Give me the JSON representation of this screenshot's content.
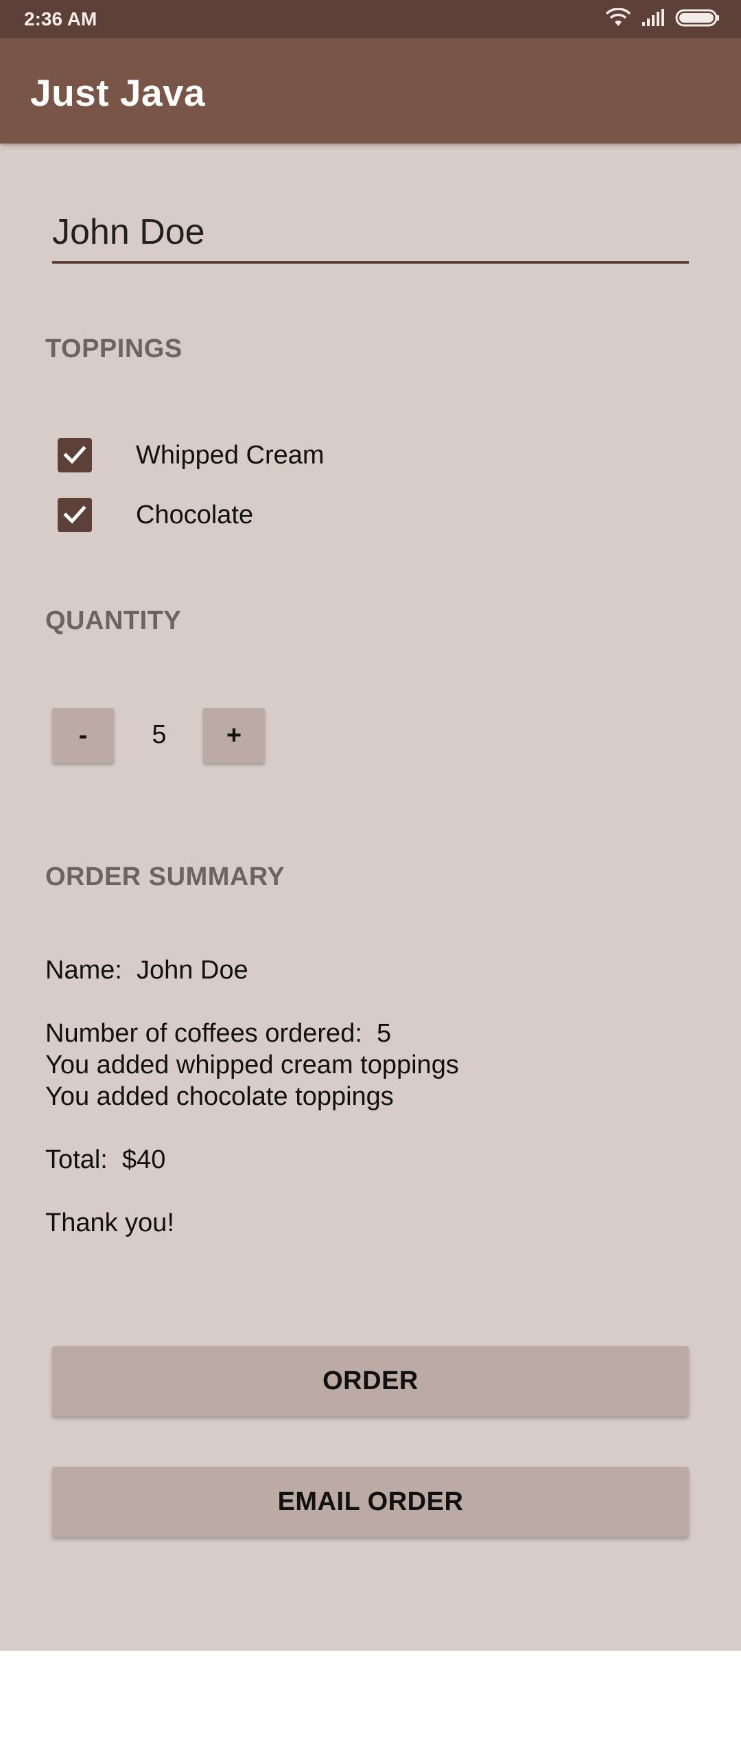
{
  "status_bar": {
    "time": "2:36 AM",
    "icons": [
      "wifi-icon",
      "signal-icon",
      "battery-icon"
    ]
  },
  "app_bar": {
    "title": "Just Java"
  },
  "name_field": {
    "value": "John Doe"
  },
  "toppings": {
    "header": "TOPPINGS",
    "items": [
      {
        "label": "Whipped Cream",
        "checked": true
      },
      {
        "label": "Chocolate",
        "checked": true
      }
    ]
  },
  "quantity": {
    "header": "QUANTITY",
    "decrement_label": "-",
    "value": "5",
    "increment_label": "+"
  },
  "order_summary": {
    "header": "ORDER SUMMARY",
    "name_line": "Name:  John Doe",
    "coffees_line": "Number of coffees ordered:  5",
    "whipped_line": "You added whipped cream toppings",
    "chocolate_line": "You added chocolate toppings",
    "total_line": "Total:  $40",
    "thanks_line": "Thank you!"
  },
  "buttons": {
    "order": "ORDER",
    "email_order": "EMAIL ORDER"
  },
  "colors": {
    "status_bar": "#5d4037",
    "app_bar": "#795548",
    "background": "#d7ccc8",
    "button": "#bcaaa4",
    "accent": "#5d4037"
  }
}
